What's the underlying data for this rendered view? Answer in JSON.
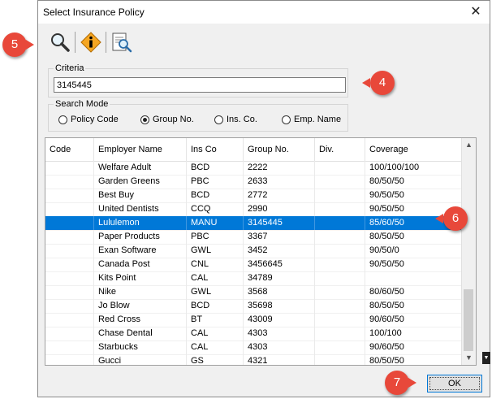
{
  "window": {
    "title": "Select Insurance Policy",
    "close_glyph": "✕"
  },
  "toolbar": {
    "buttons": [
      {
        "icon": "magnifier-search-icon"
      },
      {
        "icon": "info-diamond-icon"
      },
      {
        "icon": "document-search-icon"
      }
    ]
  },
  "criteria": {
    "label": "Criteria",
    "value": "3145445"
  },
  "search_mode": {
    "label": "Search Mode",
    "options": [
      {
        "label": "Policy Code",
        "selected": false
      },
      {
        "label": "Group No.",
        "selected": true
      },
      {
        "label": "Ins. Co.",
        "selected": false
      },
      {
        "label": "Emp. Name",
        "selected": false
      }
    ]
  },
  "grid": {
    "columns": [
      "Code",
      "Employer Name",
      "Ins Co",
      "Group No.",
      "Div.",
      "Coverage"
    ],
    "rows": [
      [
        "",
        "Welfare Adult",
        "BCD",
        "2222",
        "",
        "100/100/100"
      ],
      [
        "",
        "Garden Greens",
        "PBC",
        "2633",
        "",
        "80/50/50"
      ],
      [
        "",
        "Best Buy",
        "BCD",
        "2772",
        "",
        "90/50/50"
      ],
      [
        "",
        "United Dentists",
        "CCQ",
        "2990",
        "",
        "90/50/50"
      ],
      [
        "",
        "Lululemon",
        "MANU",
        "3145445",
        "",
        "85/60/50"
      ],
      [
        "",
        "Paper Products",
        "PBC",
        "3367",
        "",
        "80/50/50"
      ],
      [
        "",
        "Exan Software",
        "GWL",
        "3452",
        "",
        "90/50/0"
      ],
      [
        "",
        "Canada Post",
        "CNL",
        "3456645",
        "",
        "90/50/50"
      ],
      [
        "",
        "Kits Point",
        "CAL",
        "34789",
        "",
        ""
      ],
      [
        "",
        "Nike",
        "GWL",
        "3568",
        "",
        "80/60/50"
      ],
      [
        "",
        "Jo Blow",
        "BCD",
        "35698",
        "",
        "80/50/50"
      ],
      [
        "",
        "Red Cross",
        "BT",
        "43009",
        "",
        "90/60/50"
      ],
      [
        "",
        "Chase Dental",
        "CAL",
        "4303",
        "",
        "100/100"
      ],
      [
        "",
        "Starbucks",
        "CAL",
        "4303",
        "",
        "90/60/50"
      ],
      [
        "",
        "Gucci",
        "GS",
        "4321",
        "",
        "80/50/50"
      ]
    ],
    "selected_row": 4
  },
  "ok_button": {
    "label": "OK"
  },
  "callouts": [
    "5",
    "4",
    "6",
    "7"
  ],
  "colors": {
    "selection": "#0078d7",
    "callout": "#e8483a"
  }
}
